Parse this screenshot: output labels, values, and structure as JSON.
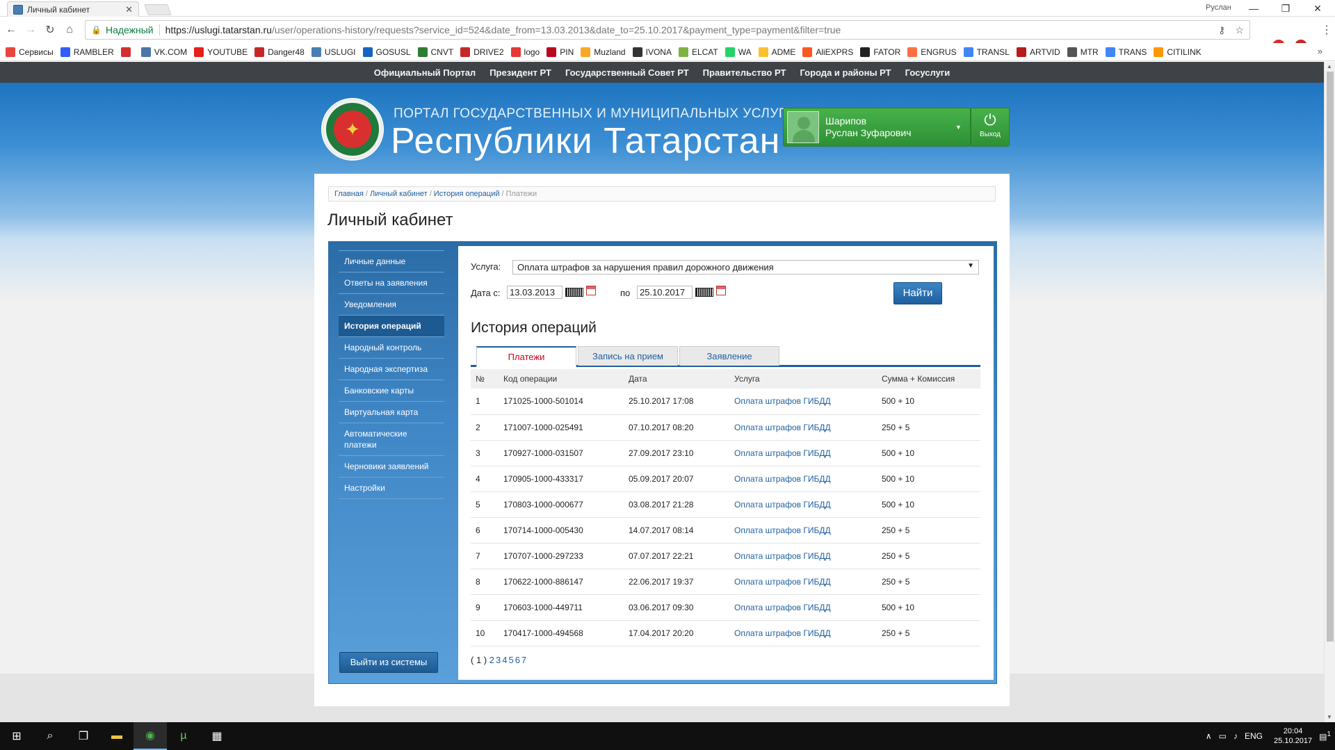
{
  "browser": {
    "tab_title": "Личный кабинет",
    "window_user": "Руслан",
    "secure_label": "Надежный",
    "url_host": "https://uslugi.tatarstan.ru",
    "url_rest": "/user/operations-history/requests?service_id=524&date_from=13.03.2013&date_to=25.10.2017&payment_type=payment&filter=true"
  },
  "bookmarks": [
    {
      "label": "Сервисы",
      "color": "#e8453c"
    },
    {
      "label": "RAMBLER",
      "color": "#315efb"
    },
    {
      "label": "",
      "color": "#d32f2f"
    },
    {
      "label": "VK.COM",
      "color": "#4a76a8"
    },
    {
      "label": "YOUTUBE",
      "color": "#e62117"
    },
    {
      "label": "Danger48",
      "color": "#c62828"
    },
    {
      "label": "USLUGI",
      "color": "#4a7fb5"
    },
    {
      "label": "GOSUSL",
      "color": "#1565c0"
    },
    {
      "label": "CNVT",
      "color": "#2e7d32"
    },
    {
      "label": "DRIVE2",
      "color": "#c62828"
    },
    {
      "label": "logo",
      "color": "#e53935"
    },
    {
      "label": "PIN",
      "color": "#bd081c"
    },
    {
      "label": "Muzland",
      "color": "#f9a825"
    },
    {
      "label": "IVONA",
      "color": "#333333"
    },
    {
      "label": "ELCAT",
      "color": "#7cb342"
    },
    {
      "label": "WA",
      "color": "#25d366"
    },
    {
      "label": "ADME",
      "color": "#fbc02d"
    },
    {
      "label": "AliEXPRS",
      "color": "#ff5722"
    },
    {
      "label": "FATOR",
      "color": "#222222"
    },
    {
      "label": "ENGRUS",
      "color": "#ff7043"
    },
    {
      "label": "TRANSL",
      "color": "#4285f4"
    },
    {
      "label": "ARTVID",
      "color": "#b71c1c"
    },
    {
      "label": "MTR",
      "color": "#555555"
    },
    {
      "label": "TRANS",
      "color": "#4285f4"
    },
    {
      "label": "CITILINK",
      "color": "#ff9800"
    }
  ],
  "topnav": [
    "Официальный Портал",
    "Президент РТ",
    "Государственный Совет РТ",
    "Правительство РТ",
    "Города и районы РТ",
    "Госуслуги"
  ],
  "header": {
    "subtitle": "ПОРТАЛ ГОСУДАРСТВЕННЫХ И МУНИЦИПАЛЬНЫХ УСЛУГ",
    "title": "Республики Татарстан",
    "user_last": "Шарипов",
    "user_first": "Руслан Зуфарович",
    "logout_label": "Выход"
  },
  "breadcrumbs": {
    "home": "Главная",
    "cabinet": "Личный кабинет",
    "history": "История операций",
    "current": "Платежи"
  },
  "page_title": "Личный кабинет",
  "sidebar": [
    {
      "label": "Личные данные"
    },
    {
      "label": "Ответы на заявления"
    },
    {
      "label": "Уведомления"
    },
    {
      "label": "История операций",
      "active": true
    },
    {
      "label": "Народный контроль"
    },
    {
      "label": "Народная экспертиза"
    },
    {
      "label": "Банковские карты"
    },
    {
      "label": "Виртуальная карта"
    },
    {
      "label": "Автоматические платежи"
    },
    {
      "label": "Черновики заявлений"
    },
    {
      "label": "Настройки"
    }
  ],
  "sidebar_logout": "Выйти из системы",
  "filter": {
    "service_label": "Услуга:",
    "service_value": "Оплата штрафов за нарушения правил дорожного движения",
    "date_from_label": "Дата с:",
    "date_from": "13.03.2013",
    "date_to_label": "по",
    "date_to": "25.10.2017",
    "find_button": "Найти"
  },
  "section_title": "История операций",
  "tabs": [
    "Платежи",
    "Запись на прием",
    "Заявление"
  ],
  "table": {
    "headers": [
      "№",
      "Код операции",
      "Дата",
      "Услуга",
      "Сумма + Комиссия"
    ],
    "rows": [
      [
        "1",
        "171025-1000-501014",
        "25.10.2017 17:08",
        "Оплата штрафов ГИБДД",
        "500 + 10"
      ],
      [
        "2",
        "171007-1000-025491",
        "07.10.2017 08:20",
        "Оплата штрафов ГИБДД",
        "250 + 5"
      ],
      [
        "3",
        "170927-1000-031507",
        "27.09.2017 23:10",
        "Оплата штрафов ГИБДД",
        "500 + 10"
      ],
      [
        "4",
        "170905-1000-433317",
        "05.09.2017 20:07",
        "Оплата штрафов ГИБДД",
        "500 + 10"
      ],
      [
        "5",
        "170803-1000-000677",
        "03.08.2017 21:28",
        "Оплата штрафов ГИБДД",
        "500 + 10"
      ],
      [
        "6",
        "170714-1000-005430",
        "14.07.2017 08:14",
        "Оплата штрафов ГИБДД",
        "250 + 5"
      ],
      [
        "7",
        "170707-1000-297233",
        "07.07.2017 22:21",
        "Оплата штрафов ГИБДД",
        "250 + 5"
      ],
      [
        "8",
        "170622-1000-886147",
        "22.06.2017 19:37",
        "Оплата штрафов ГИБДД",
        "250 + 5"
      ],
      [
        "9",
        "170603-1000-449711",
        "03.06.2017 09:30",
        "Оплата штрафов ГИБДД",
        "500 + 10"
      ],
      [
        "10",
        "170417-1000-494568",
        "17.04.2017 20:20",
        "Оплата штрафов ГИБДД",
        "250 + 5"
      ]
    ]
  },
  "pager": {
    "current": "( 1 )",
    "pages": [
      "2",
      "3",
      "4",
      "5",
      "6",
      "7"
    ]
  },
  "taskbar": {
    "lang": "ENG",
    "time": "20:04",
    "date": "25.10.2017",
    "notif": "1"
  }
}
